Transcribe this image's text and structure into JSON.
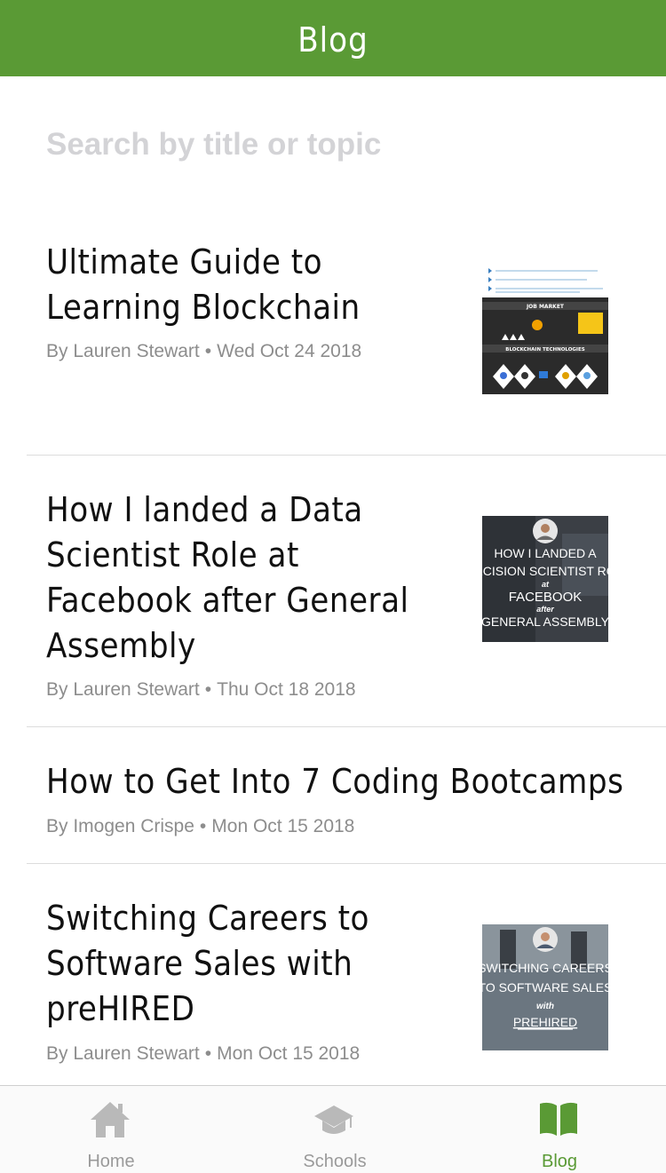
{
  "header": {
    "title": "Blog"
  },
  "search": {
    "placeholder": "Search by title or topic"
  },
  "posts": [
    {
      "title_lines": [
        "Ultimate Guide to",
        "Learning Blockchain"
      ],
      "author": "By Lauren Stewart",
      "date": "Wed Oct 24 2018",
      "thumbnail": {
        "kind": "infographic",
        "heading_1": "JOB MARKET",
        "heading_2": "BLOCKCHAIN TECHNOLOGIES"
      }
    },
    {
      "title_lines": [
        "How I landed a Data",
        "Scientist Role at",
        "Facebook after General",
        "Assembly"
      ],
      "author": "By Lauren Stewart",
      "date": "Thu Oct 18 2018",
      "thumbnail": {
        "kind": "cover",
        "lines": [
          "HOW I LANDED A",
          "ECISION SCIENTIST RO",
          "at",
          "FACEBOOK",
          "after",
          "GENERAL ASSEMBLY"
        ]
      }
    },
    {
      "title_lines": [
        "How to Get Into 7 Coding Bootcamps"
      ],
      "author": "By Imogen Crispe",
      "date": "Mon Oct 15 2018",
      "thumbnail": null
    },
    {
      "title_lines": [
        "Switching Careers to",
        "Software Sales with",
        "preHIRED"
      ],
      "author": "By Lauren Stewart",
      "date": "Mon Oct 15 2018",
      "thumbnail": {
        "kind": "cover",
        "lines": [
          "SWITCHING CAREERS",
          "TO SOFTWARE SALES",
          "with",
          "PREHIRED"
        ]
      }
    }
  ],
  "meta_separator": "•",
  "tabbar": {
    "items": [
      {
        "label": "Home",
        "icon": "home-icon",
        "active": false
      },
      {
        "label": "Schools",
        "icon": "graduation-cap-icon",
        "active": false
      },
      {
        "label": "Blog",
        "icon": "book-icon",
        "active": true
      }
    ]
  },
  "colors": {
    "brand": "#5a9a35",
    "inactive": "#9a9a9a",
    "meta": "#8d8d8d"
  }
}
